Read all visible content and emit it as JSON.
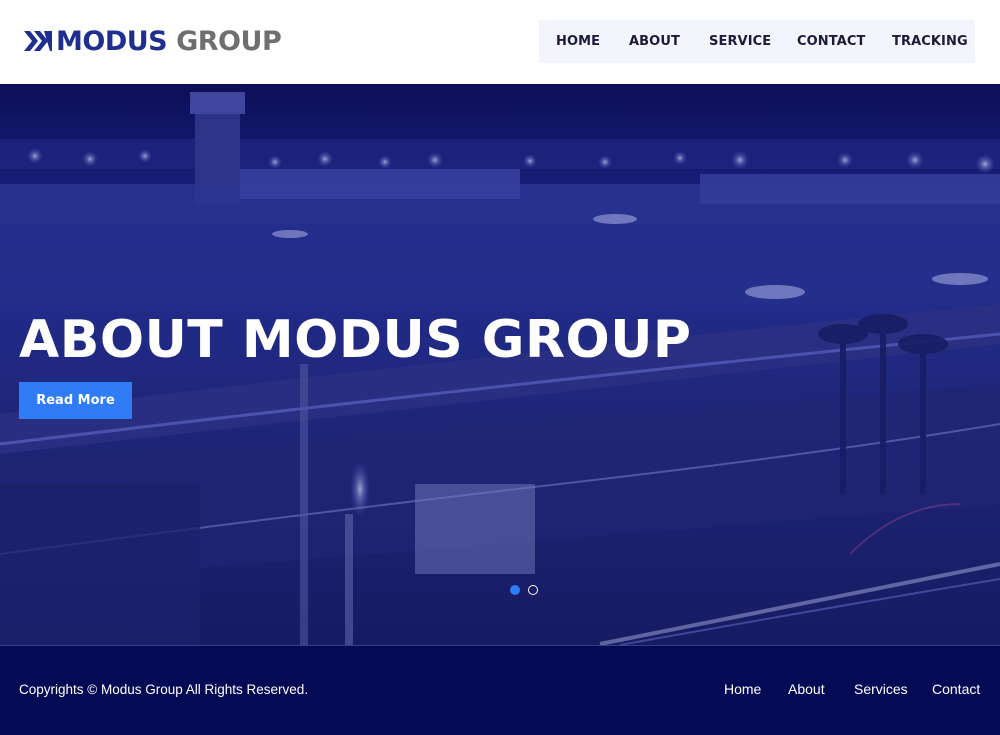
{
  "brand": {
    "name_part1": "MODUS",
    "name_part2": "GROUP",
    "icon": "modus-logo-icon",
    "primary_color": "#1e2f8f",
    "secondary_color": "#6f6f6f"
  },
  "nav": {
    "items": [
      {
        "label": "HOME"
      },
      {
        "label": "ABOUT"
      },
      {
        "label": "SERVICE"
      },
      {
        "label": "CONTACT"
      },
      {
        "label": "TRACKING"
      }
    ]
  },
  "hero": {
    "title": "ABOUT MODUS GROUP",
    "button_label": "Read More",
    "button_color": "#2f7cf6",
    "slides": 2,
    "active_slide": 1
  },
  "footer": {
    "copyright": "Copyrights © Modus Group All Rights Reserved.",
    "links": [
      {
        "label": "Home"
      },
      {
        "label": "About"
      },
      {
        "label": "Services"
      },
      {
        "label": "Contact"
      }
    ],
    "background": "#050a55"
  }
}
